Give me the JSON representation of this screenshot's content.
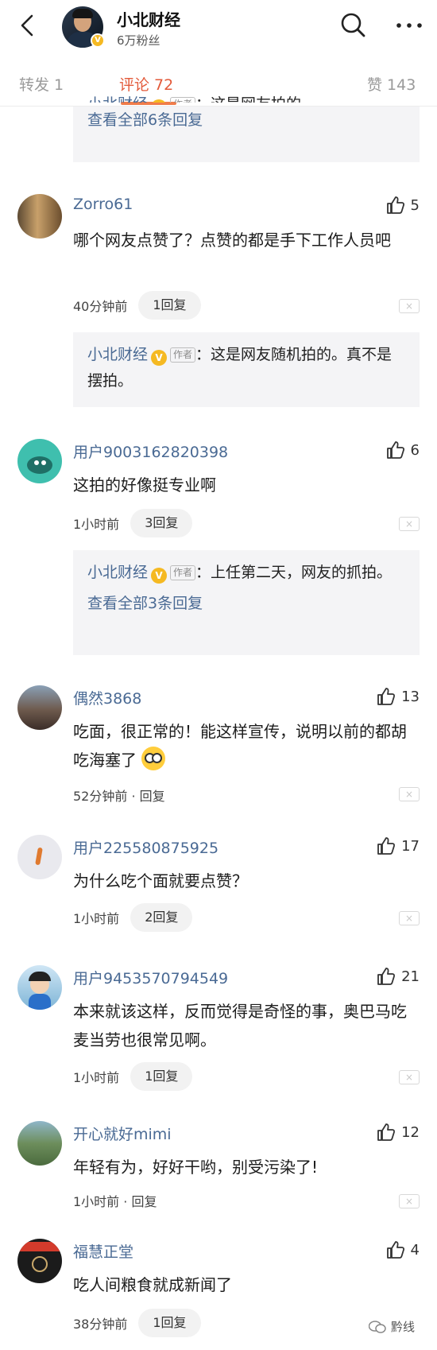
{
  "header": {
    "title": "小北财经",
    "fans": "6万粉丝",
    "verified": "V"
  },
  "tabs": [
    {
      "label": "转发 1"
    },
    {
      "label": "评论 72",
      "active": true
    },
    {
      "label": "赞 143"
    }
  ],
  "top_reply_partial": {
    "author": "小北财经",
    "tag": "作者",
    "text": "：这是网友拍的。",
    "view_all": "查看全部6条回复"
  },
  "comments": [
    {
      "name": "Zorro61",
      "likes": "5",
      "text": "哪个网友点赞了？点赞的都是手下工作人员吧",
      "time": "40分钟前",
      "replies": "1回复",
      "reply": {
        "author": "小北财经",
        "tag": "作者",
        "text": "：这是网友随机拍的。真不是摆拍。"
      }
    },
    {
      "name": "用户9003162820398",
      "likes": "6",
      "text": "这拍的好像挺专业啊",
      "time": "1小时前",
      "replies": "3回复",
      "reply": {
        "author": "小北财经",
        "tag": "作者",
        "text": "：上任第二天，网友的抓拍。",
        "view_all": "查看全部3条回复"
      }
    },
    {
      "name": "偶然3868",
      "likes": "13",
      "text": "吃面，很正常的！能这样宣传，说明以前的都胡吃海塞了",
      "time": "52分钟前 · 回复"
    },
    {
      "name": "用户225580875925",
      "likes": "17",
      "text": "为什么吃个面就要点赞？",
      "time": "1小时前",
      "replies": "2回复"
    },
    {
      "name": "用户9453570794549",
      "likes": "21",
      "text": "本来就该这样，反而觉得是奇怪的事，奥巴马吃麦当劳也很常见啊。",
      "time": "1小时前",
      "replies": "1回复"
    },
    {
      "name": "开心就好mimi",
      "likes": "12",
      "text": "年轻有为，好好干哟，别受污染了!",
      "time": "1小时前 · 回复"
    },
    {
      "name": "福慧正堂",
      "likes": "4",
      "text": "吃人间粮食就成新闻了",
      "time": "38分钟前",
      "replies": "1回复"
    }
  ],
  "close_label": "×",
  "watermark": "黔线"
}
